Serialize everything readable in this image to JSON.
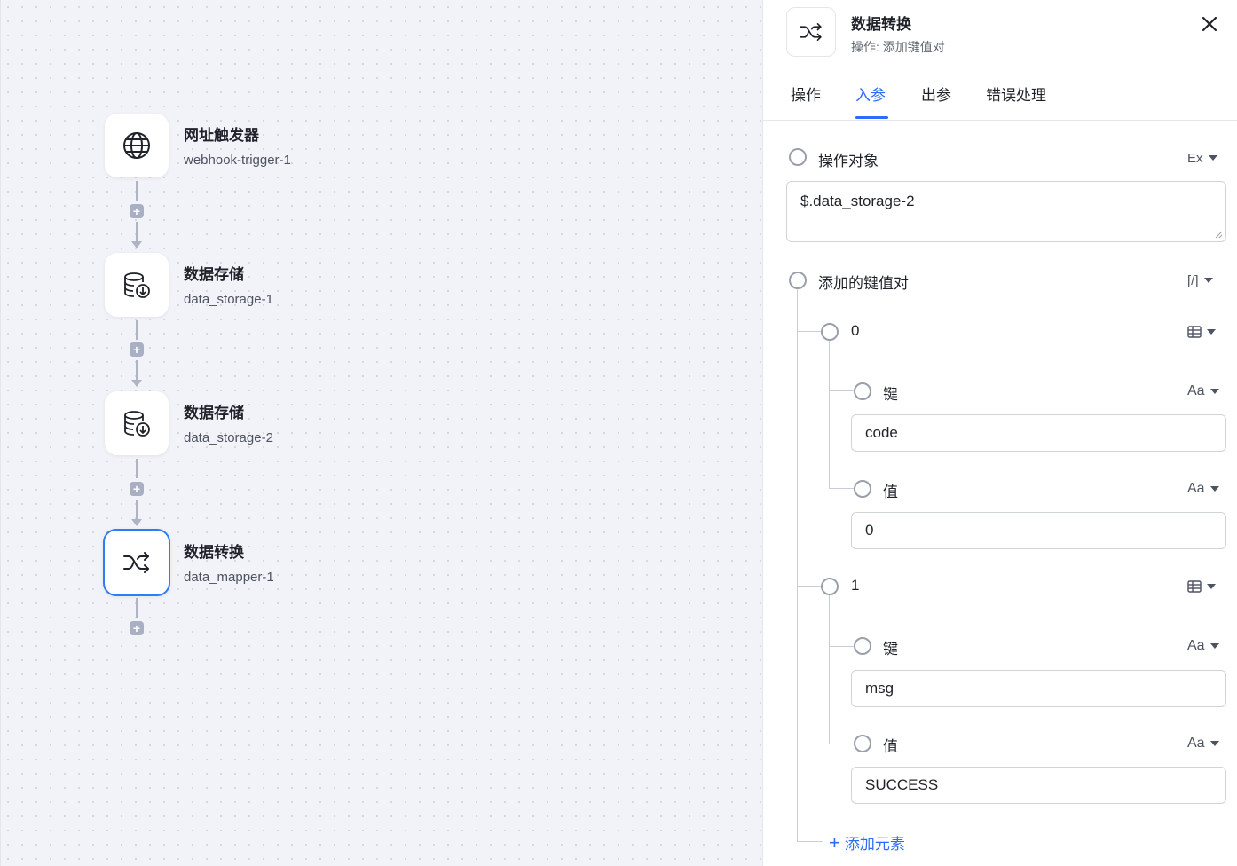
{
  "flow": {
    "nodes": [
      {
        "title": "网址触发器",
        "subtitle": "webhook-trigger-1",
        "icon": "globe-icon",
        "selected": false
      },
      {
        "title": "数据存储",
        "subtitle": "data_storage-1",
        "icon": "database-download-icon",
        "selected": false
      },
      {
        "title": "数据存储",
        "subtitle": "data_storage-2",
        "icon": "database-download-icon",
        "selected": false
      },
      {
        "title": "数据转换",
        "subtitle": "data_mapper-1",
        "icon": "shuffle-icon",
        "selected": true
      }
    ],
    "add_glyph": "+"
  },
  "panel": {
    "title": "数据转换",
    "subtitle_label": "操作:",
    "subtitle_value": "添加键值对",
    "icon": "shuffle-icon",
    "tabs": [
      {
        "label": "操作",
        "active": false
      },
      {
        "label": "入参",
        "active": true
      },
      {
        "label": "出参",
        "active": false
      },
      {
        "label": "错误处理",
        "active": false
      }
    ],
    "target_field": {
      "label": "操作对象",
      "type_label": "Ex",
      "value": "$.data_storage-2"
    },
    "pairs_field": {
      "label": "添加的键值对",
      "type_label": "[/]"
    },
    "items": [
      {
        "index": "0",
        "key": {
          "label": "键",
          "type_label": "Aa",
          "value": "code"
        },
        "value": {
          "label": "值",
          "type_label": "Aa",
          "value": "0"
        }
      },
      {
        "index": "1",
        "key": {
          "label": "键",
          "type_label": "Aa",
          "value": "msg"
        },
        "value": {
          "label": "值",
          "type_label": "Aa",
          "value": "SUCCESS"
        }
      }
    ],
    "add_element_label": "添加元素",
    "accent_color": "#2e6bf6",
    "selected_node_border": "#2e7cf6"
  }
}
